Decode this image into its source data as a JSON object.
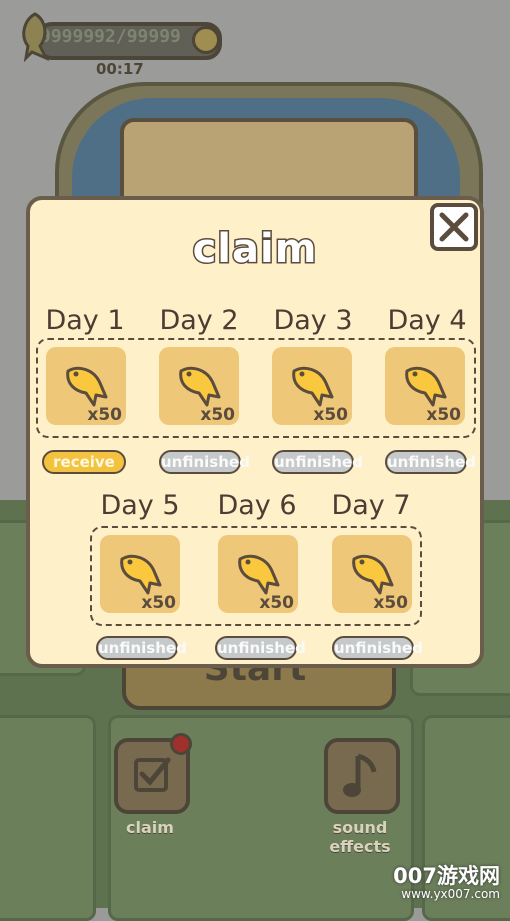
{
  "hud": {
    "currency": "9999992/99999",
    "timer": "00:17"
  },
  "background": {
    "start_label": "Start"
  },
  "dialog": {
    "title": "claim",
    "days_row1": [
      {
        "label": "Day 1",
        "qty": "x50",
        "status": "receive",
        "state": "done"
      },
      {
        "label": "Day 2",
        "qty": "x50",
        "status": "unfinished",
        "state": "todo"
      },
      {
        "label": "Day 3",
        "qty": "x50",
        "status": "unfinished",
        "state": "todo"
      },
      {
        "label": "Day 4",
        "qty": "x50",
        "status": "unfinished",
        "state": "todo"
      }
    ],
    "days_row2": [
      {
        "label": "Day 5",
        "qty": "x50",
        "status": "unfinished",
        "state": "todo"
      },
      {
        "label": "Day 6",
        "qty": "x50",
        "status": "unfinished",
        "state": "todo"
      },
      {
        "label": "Day 7",
        "qty": "x50",
        "status": "unfinished",
        "state": "todo"
      }
    ]
  },
  "bottom_bar": {
    "claim_label": "claim",
    "sound_label": "sound effects"
  },
  "watermark": {
    "main": "007游戏网",
    "sub": "www.yx007.com"
  },
  "icons": {
    "reward": "fish-icon",
    "close": "close-icon",
    "claim": "checkbox-icon",
    "sound": "music-note-icon"
  },
  "colors": {
    "dialog_bg": "#fef0c8",
    "reward_bg": "#efc779",
    "receive": "#f3c23e",
    "unfinished": "#c5c9c9"
  }
}
